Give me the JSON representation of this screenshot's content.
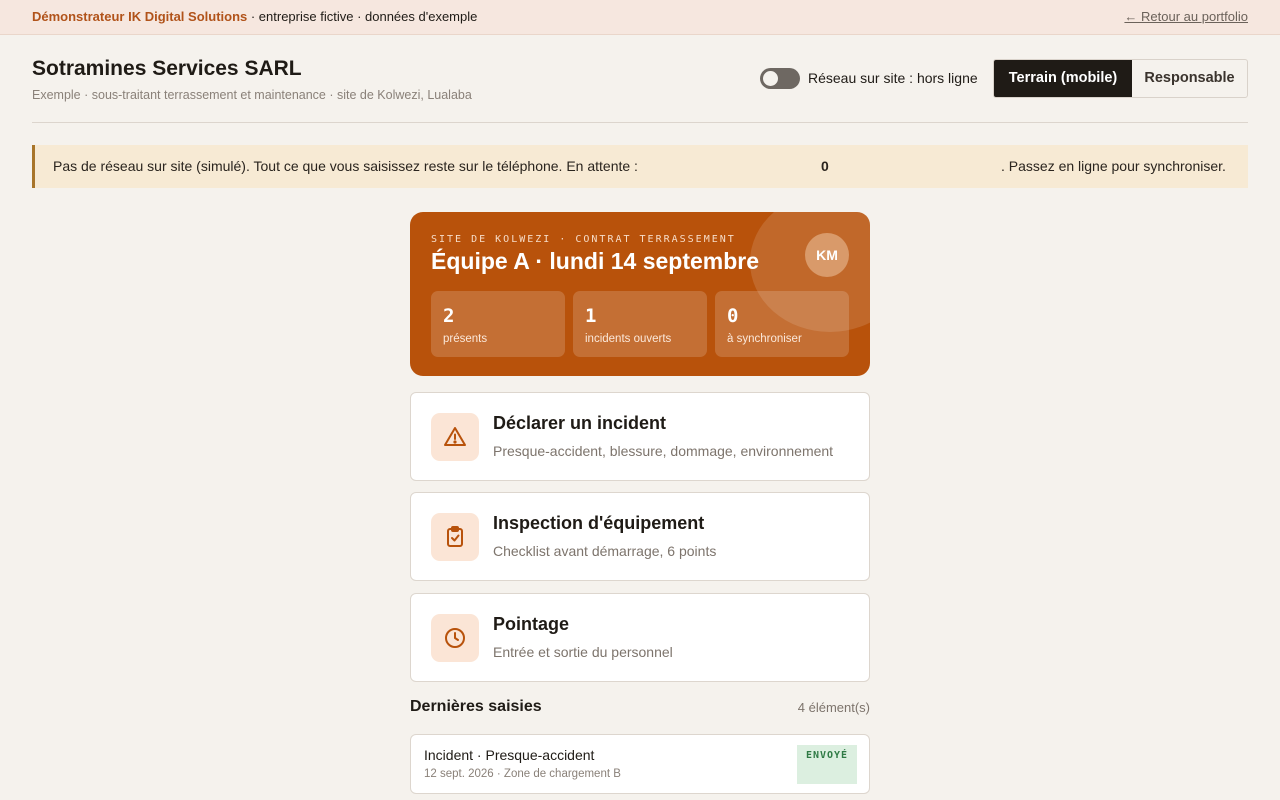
{
  "topbar": {
    "brand": "Démonstrateur IK Digital Solutions",
    "brand_suffix": " · entreprise fictive · données d'exemple",
    "back_link": "← Retour au portfolio"
  },
  "header": {
    "company": "Sotramines Services SARL",
    "subtitle": "Exemple · sous-traitant terrassement et maintenance · site de Kolwezi, Lualaba",
    "network_toggle_label": "Réseau sur site : hors ligne",
    "network_online": false,
    "view_modes": [
      "Terrain (mobile)",
      "Responsable"
    ],
    "active_view": "Terrain (mobile)"
  },
  "banner": {
    "text_before": "Pas de réseau sur site (simulé). Tout ce que vous saisissez reste sur le téléphone. En attente :",
    "pending_count": "0",
    "text_after": ". Passez en ligne pour synchroniser."
  },
  "hero": {
    "eyebrow": "SITE DE KOLWEZI · CONTRAT TERRASSEMENT",
    "title": "Équipe A · lundi 14 septembre",
    "avatar_initials": "KM",
    "stats": [
      {
        "value": "2",
        "label": "présents"
      },
      {
        "value": "1",
        "label": "incidents ouverts"
      },
      {
        "value": "0",
        "label": "à synchroniser"
      }
    ]
  },
  "actions": [
    {
      "title": "Déclarer un incident",
      "subtitle": "Presque-accident, blessure, dommage, environnement",
      "icon": "warning-triangle-icon"
    },
    {
      "title": "Inspection d'équipement",
      "subtitle": "Checklist avant démarrage, 6 points",
      "icon": "clipboard-check-icon"
    },
    {
      "title": "Pointage",
      "subtitle": "Entrée et sortie du personnel",
      "icon": "clock-icon"
    }
  ],
  "recent": {
    "title": "Dernières saisies",
    "count_label": "4 élément(s)",
    "items": [
      {
        "title": "Incident · Presque-accident",
        "meta": "12 sept. 2026 · Zone de chargement B",
        "status": "ENVOYÉ"
      }
    ]
  },
  "colors": {
    "accent": "#b8520b",
    "background": "#f5f2ed",
    "banner": "#f7ead4",
    "status_sent": "#2f7a45"
  }
}
